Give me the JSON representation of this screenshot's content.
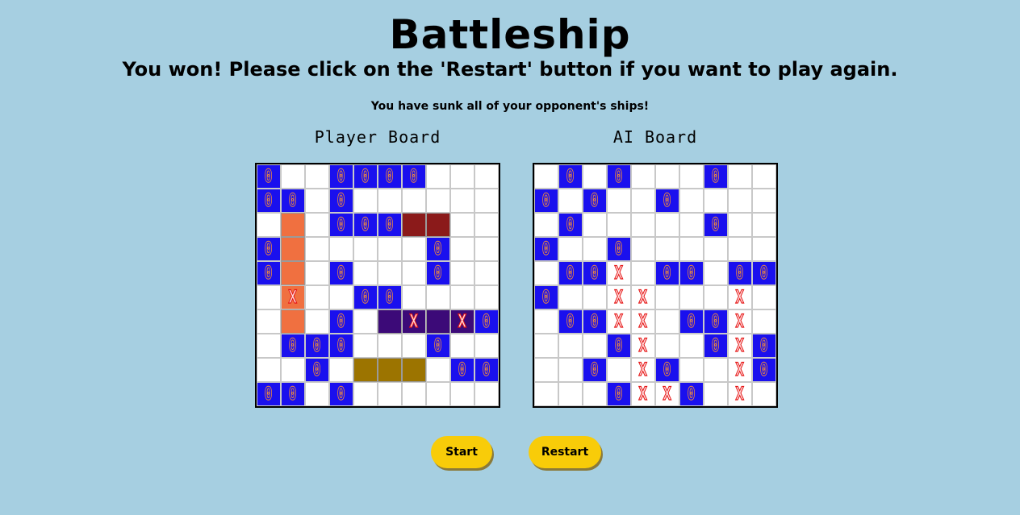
{
  "title": "Battleship",
  "message": "You won! Please click on the 'Restart' button if you want to play again.",
  "submessage": "You have sunk all of your opponent's ships!",
  "colors": {
    "background": "#a6cfe1",
    "miss": "#1a10ee",
    "miss_mark": "#f08a3c",
    "hit_mark": "#e51414",
    "button": "#f8cc09",
    "ship_a": "#f07040",
    "ship_b": "#8b1a1a",
    "ship_c": "#3c0a78",
    "ship_d": "#9c7400"
  },
  "cell_legend": {
    ".": "empty",
    "o": "miss",
    "A": "ship_a",
    "B": "ship_b",
    "C": "ship_c",
    "D": "ship_d",
    "x": "hit_empty",
    "a": "hit_ship_a",
    "c": "hit_ship_c"
  },
  "mark_miss": "0",
  "mark_hit": "X",
  "player_board": {
    "label": "Player Board",
    "rows": [
      "o..oooo...",
      "oo.o......",
      ".A.oooBB..",
      "oA.....o..",
      "oA.o...o..",
      ".a..oo....",
      ".A.o.CcCco",
      ".ooo...o..",
      "..o.DDD.oo",
      "oo.o......"
    ]
  },
  "ai_board": {
    "label": "AI Board",
    "rows": [
      ".o.o...o..",
      "o.o..o....",
      ".o.....o..",
      "o..o......",
      ".oox.oo.oo",
      "o..xx...x.",
      ".ooxx.oox.",
      "...ox..oxo",
      "..o.xo..xo",
      "...oxxo.x."
    ]
  },
  "buttons": {
    "start": "Start",
    "restart": "Restart"
  }
}
